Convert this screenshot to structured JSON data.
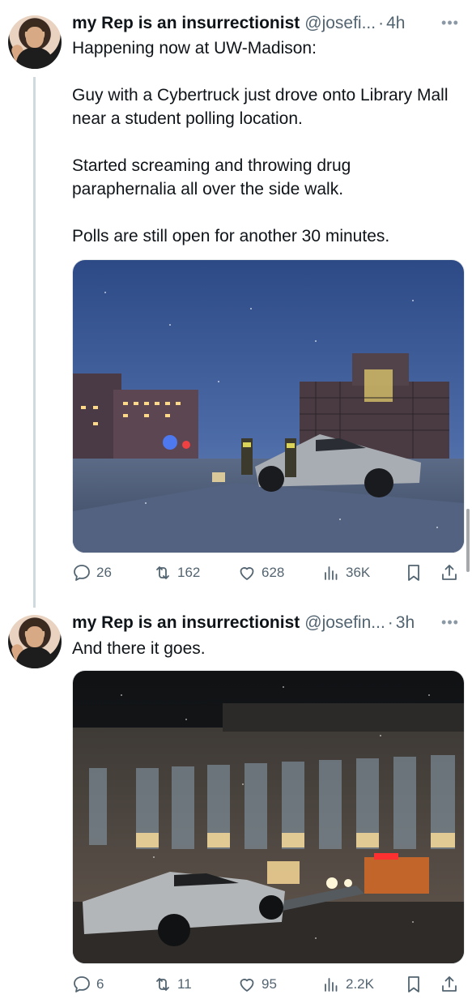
{
  "tweets": [
    {
      "author_name": "my Rep is an insurrectionist",
      "handle": "@josefi...",
      "separator": "·",
      "time": "4h",
      "paragraphs": [
        "Happening now at UW-Madison:",
        "Guy with a Cybertruck just drove onto Library Mall near a student polling location.",
        "Started screaming and throwing drug paraphernalia all over the side walk.",
        "Polls are still open for another 30 minutes."
      ],
      "stats": {
        "replies": "26",
        "reposts": "162",
        "likes": "628",
        "views": "36K"
      }
    },
    {
      "author_name": "my Rep is an insurrectionist",
      "handle": "@josefin...",
      "separator": "·",
      "time": "3h",
      "paragraphs": [
        "And there it goes."
      ],
      "stats": {
        "replies": "6",
        "reposts": "11",
        "likes": "95",
        "views": "2.2K"
      }
    }
  ],
  "icons": {
    "more": "more-horizontal-icon",
    "reply": "reply-icon",
    "repost": "repost-icon",
    "like": "heart-icon",
    "views": "views-icon",
    "bookmark": "bookmark-icon",
    "share": "share-icon"
  },
  "colors": {
    "text": "#0f1419",
    "secondary": "#536471",
    "thread_line": "#cfd9de"
  }
}
